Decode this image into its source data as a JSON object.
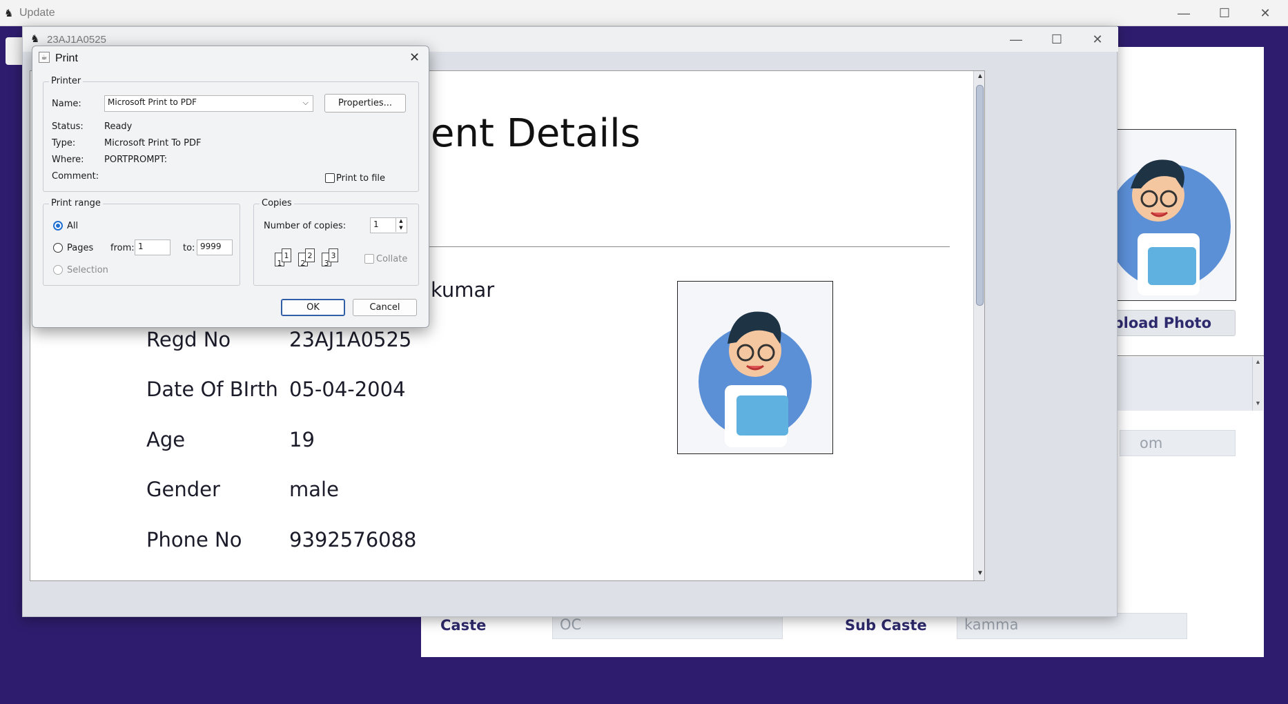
{
  "app_window": {
    "title": "Update",
    "controls": {
      "minimize": "—",
      "maximize": "☐",
      "close": "✕"
    }
  },
  "form_panel": {
    "upload_button": "Upload Photo",
    "email_partial": "om",
    "caste_label": "Caste",
    "caste_value": "OC",
    "subcaste_label": "Sub Caste",
    "subcaste_value": "kamma"
  },
  "viewer_window": {
    "title": "23AJ1A0525",
    "controls": {
      "minimize": "—",
      "maximize": "☐",
      "close": "✕"
    },
    "document": {
      "heading_partial": "ent Details",
      "name_partial": "kumar",
      "rows": [
        {
          "label": "Regd No",
          "value": "23AJ1A0525"
        },
        {
          "label": "Date Of BIrth",
          "value": "05-04-2004"
        },
        {
          "label": "Age",
          "value": "19"
        },
        {
          "label": "Gender",
          "value": "male"
        },
        {
          "label": "Phone No",
          "value": "9392576088"
        }
      ]
    }
  },
  "print_dialog": {
    "title": "Print",
    "printer_group": "Printer",
    "name_label": "Name:",
    "name_value": "Microsoft Print to PDF",
    "properties_button": "Properties...",
    "status_label": "Status:",
    "status_value": "Ready",
    "type_label": "Type:",
    "type_value": "Microsoft Print To PDF",
    "where_label": "Where:",
    "where_value": "PORTPROMPT:",
    "comment_label": "Comment:",
    "print_to_file": "Print to file",
    "print_range_group": "Print range",
    "range_all": "All",
    "range_pages": "Pages",
    "from_label": "from:",
    "from_value": "1",
    "to_label": "to:",
    "to_value": "9999",
    "range_selection": "Selection",
    "copies_group": "Copies",
    "copies_label": "Number of copies:",
    "copies_value": "1",
    "collate_label": "Collate",
    "collate_icons": [
      "1",
      "1",
      "2",
      "2",
      "3",
      "3"
    ],
    "ok_button": "OK",
    "cancel_button": "Cancel",
    "close_glyph": "✕"
  }
}
